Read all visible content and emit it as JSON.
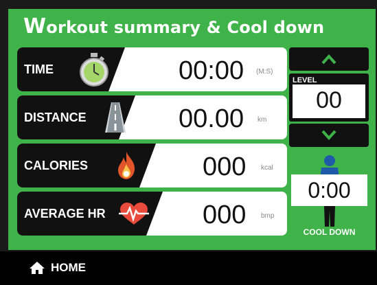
{
  "title_first": "W",
  "title_rest": "orkout summary & Cool down",
  "rows": [
    {
      "label": "TIME",
      "value": "00:00",
      "unit": "(M:S)",
      "icon": "stopwatch-icon"
    },
    {
      "label": "DISTANCE",
      "value": "00.00",
      "unit": "km",
      "icon": "road-icon"
    },
    {
      "label": "CALORIES",
      "value": "000",
      "unit": "kcal",
      "icon": "flame-icon"
    },
    {
      "label": "AVERAGE HR",
      "value": "000",
      "unit": "bmp",
      "icon": "heart-rate-icon"
    }
  ],
  "level": {
    "label": "LEVEL",
    "value": "00"
  },
  "cooldown": {
    "time": "0:00",
    "label": "COOL DOWN"
  },
  "footer": {
    "home_label": "HOME"
  },
  "colors": {
    "accent": "#3fb34a",
    "dark": "#111111"
  }
}
